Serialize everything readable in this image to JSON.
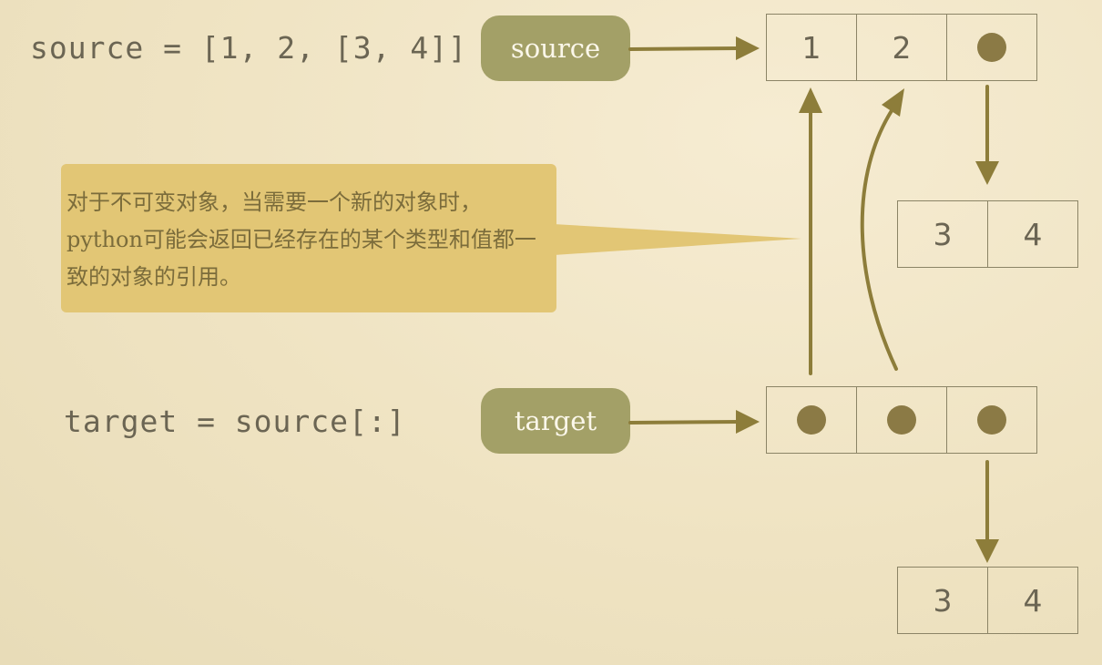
{
  "code": {
    "source_line": "source = [1, 2, [3, 4]]",
    "target_line": "target = source[:]"
  },
  "labels": {
    "source": "source",
    "target": "target"
  },
  "source_list": {
    "cells": [
      "1",
      "2",
      "•"
    ]
  },
  "source_nested": {
    "cells": [
      "3",
      "4"
    ]
  },
  "target_list": {
    "cells": [
      "•",
      "•",
      "•"
    ]
  },
  "target_nested": {
    "cells": [
      "3",
      "4"
    ]
  },
  "callout": {
    "text": "对于不可变对象，当需要一个新的对象时，python可能会返回已经存在的某个类型和值都一致的对象的引用。"
  },
  "colors": {
    "pill": "#a3a067",
    "arrow": "#8d7d3a",
    "callout": "#e2c675",
    "dot": "#8b7a45"
  }
}
